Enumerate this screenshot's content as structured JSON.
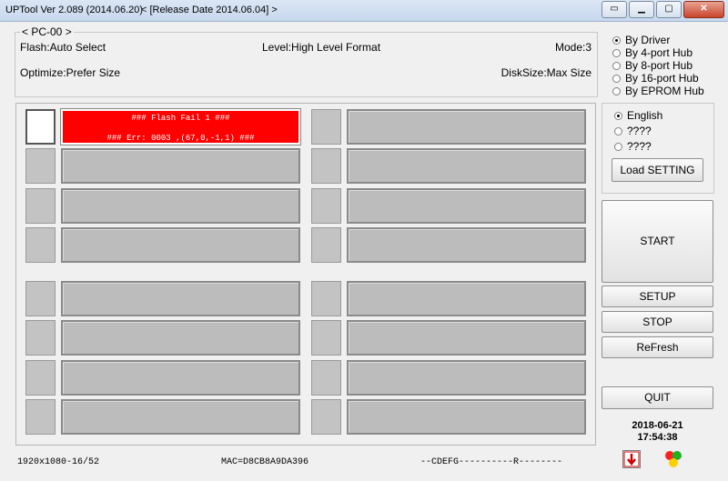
{
  "window": {
    "title": "UPTool Ver 2.089 (2014.06.20)",
    "release": "< [Release Date 2014.06.04] >"
  },
  "info": {
    "group_label": "< PC-00 >",
    "flash": "Flash:Auto Select",
    "level": "Level:High Level Format",
    "mode": "Mode:3",
    "optimize": "Optimize:Prefer Size",
    "disksize": "DiskSize:Max Size"
  },
  "hub_options": [
    {
      "label": "By Driver",
      "selected": true
    },
    {
      "label": "By 4-port Hub",
      "selected": false
    },
    {
      "label": "By 8-port Hub",
      "selected": false
    },
    {
      "label": "By 16-port Hub",
      "selected": false
    },
    {
      "label": "By EPROM Hub",
      "selected": false
    }
  ],
  "language_options": [
    {
      "label": "English",
      "selected": true
    },
    {
      "label": "????",
      "selected": false
    },
    {
      "label": "????",
      "selected": false
    }
  ],
  "buttons": {
    "load_setting": "Load SETTING",
    "start": "START",
    "setup": "SETUP",
    "stop": "STOP",
    "refresh": "ReFresh",
    "quit": "QUIT"
  },
  "fail_slot": {
    "line1": "### Flash Fail 1 ###",
    "line2": "### Err: 0003 ,(67,0,-1,1) ###"
  },
  "datetime": {
    "date": "2018-06-21",
    "time": "17:54:38"
  },
  "status": {
    "resolution": "1920x1080-16/52",
    "mac": "MAC=D8CB8A9DA396",
    "drives": "--CDEFG----------R--------"
  },
  "colors": {
    "fail": "#ff0000",
    "slot": "#bcbcbc"
  }
}
